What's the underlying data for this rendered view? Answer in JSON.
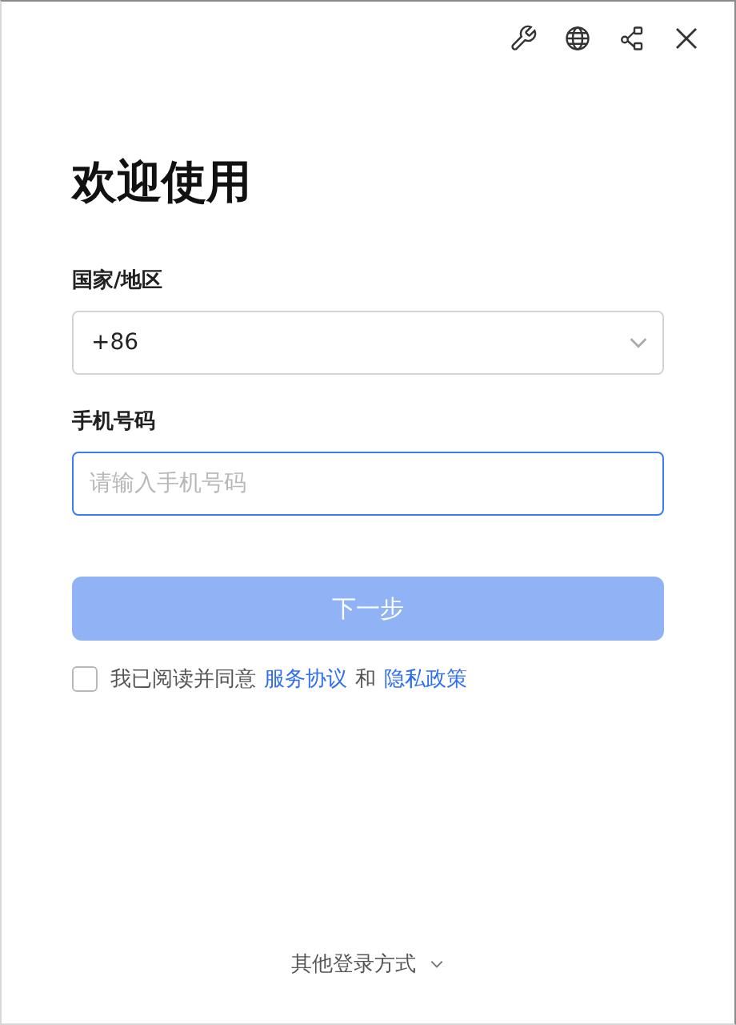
{
  "title": "欢迎使用",
  "region": {
    "label": "国家/地区",
    "value": "+86"
  },
  "phone": {
    "label": "手机号码",
    "placeholder": "请输入手机号码",
    "focused": true
  },
  "next_button": {
    "label": "下一步",
    "disabled": true
  },
  "agreement": {
    "checked": false,
    "parts": [
      {
        "kind": "text",
        "text": "我已阅读并同意"
      },
      {
        "kind": "link",
        "text": "服务协议"
      },
      {
        "kind": "text",
        "text": "和"
      },
      {
        "kind": "link",
        "text": "隐私政策"
      }
    ]
  },
  "other_login": {
    "label": "其他登录方式"
  }
}
